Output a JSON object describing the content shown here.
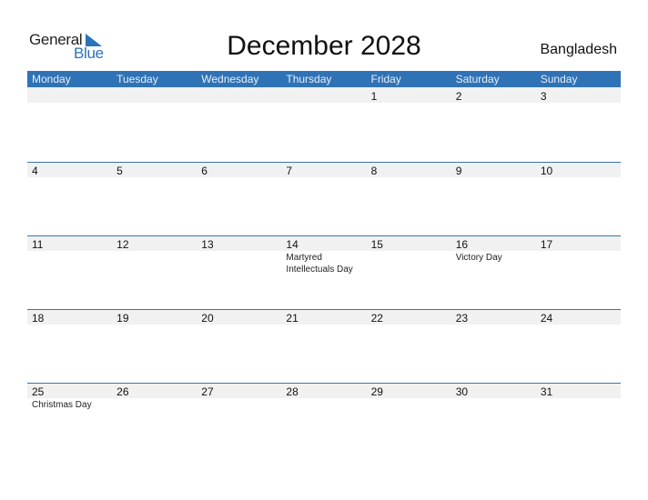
{
  "logo": {
    "general": "General",
    "blue": "Blue",
    "accent": "#2a73b8"
  },
  "title": "December 2028",
  "country": "Bangladesh",
  "header_color": "#2f73b6",
  "weekdays": [
    "Monday",
    "Tuesday",
    "Wednesday",
    "Thursday",
    "Friday",
    "Saturday",
    "Sunday"
  ],
  "weeks": [
    {
      "days": [
        {
          "num": "",
          "event": ""
        },
        {
          "num": "",
          "event": ""
        },
        {
          "num": "",
          "event": ""
        },
        {
          "num": "",
          "event": ""
        },
        {
          "num": "1",
          "event": ""
        },
        {
          "num": "2",
          "event": ""
        },
        {
          "num": "3",
          "event": ""
        }
      ]
    },
    {
      "days": [
        {
          "num": "4",
          "event": ""
        },
        {
          "num": "5",
          "event": ""
        },
        {
          "num": "6",
          "event": ""
        },
        {
          "num": "7",
          "event": ""
        },
        {
          "num": "8",
          "event": ""
        },
        {
          "num": "9",
          "event": ""
        },
        {
          "num": "10",
          "event": ""
        }
      ]
    },
    {
      "days": [
        {
          "num": "11",
          "event": ""
        },
        {
          "num": "12",
          "event": ""
        },
        {
          "num": "13",
          "event": ""
        },
        {
          "num": "14",
          "event": "Martyred Intellectuals Day"
        },
        {
          "num": "15",
          "event": ""
        },
        {
          "num": "16",
          "event": "Victory Day"
        },
        {
          "num": "17",
          "event": ""
        }
      ]
    },
    {
      "days": [
        {
          "num": "18",
          "event": ""
        },
        {
          "num": "19",
          "event": ""
        },
        {
          "num": "20",
          "event": ""
        },
        {
          "num": "21",
          "event": ""
        },
        {
          "num": "22",
          "event": ""
        },
        {
          "num": "23",
          "event": ""
        },
        {
          "num": "24",
          "event": ""
        }
      ]
    },
    {
      "days": [
        {
          "num": "25",
          "event": "Christmas Day"
        },
        {
          "num": "26",
          "event": ""
        },
        {
          "num": "27",
          "event": ""
        },
        {
          "num": "28",
          "event": ""
        },
        {
          "num": "29",
          "event": ""
        },
        {
          "num": "30",
          "event": ""
        },
        {
          "num": "31",
          "event": ""
        }
      ]
    }
  ]
}
